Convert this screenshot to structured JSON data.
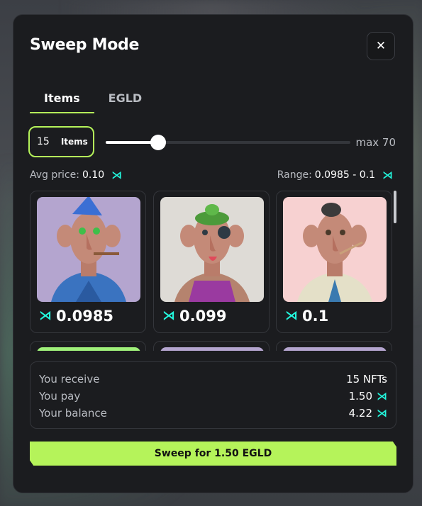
{
  "modal": {
    "title": "Sweep Mode",
    "close_icon": "close-icon"
  },
  "tabs": [
    {
      "label": "Items",
      "active": true
    },
    {
      "label": "EGLD",
      "active": false
    }
  ],
  "quantity": {
    "value": "15",
    "unit": "Items",
    "slider_fraction": 0.214,
    "max_label": "max 70"
  },
  "stats": {
    "avg_label": "Avg price:",
    "avg_value": "0.10",
    "range_label": "Range:",
    "range_value": "0.0985 - 0.1",
    "currency_icon": "egld-icon"
  },
  "items": [
    {
      "price": "0.0985",
      "bg": "#b4a5cf",
      "outfit": "#3a73c0",
      "hat": "party-hat"
    },
    {
      "price": "0.099",
      "bg": "#dedbd6",
      "outfit": "#9a3aa0",
      "hat": "frog"
    },
    {
      "price": "0.1",
      "bg": "#f7d1d1",
      "outfit": "#e4e0c8",
      "hat": "bun"
    }
  ],
  "summary": {
    "receive_label": "You receive",
    "receive_value": "15 NFTs",
    "pay_label": "You pay",
    "pay_value": "1.50",
    "balance_label": "Your balance",
    "balance_value": "4.22"
  },
  "action": {
    "sweep_label": "Sweep for 1.50 EGLD"
  },
  "colors": {
    "accent": "#b5f35a",
    "egld": "#23f7dd"
  }
}
